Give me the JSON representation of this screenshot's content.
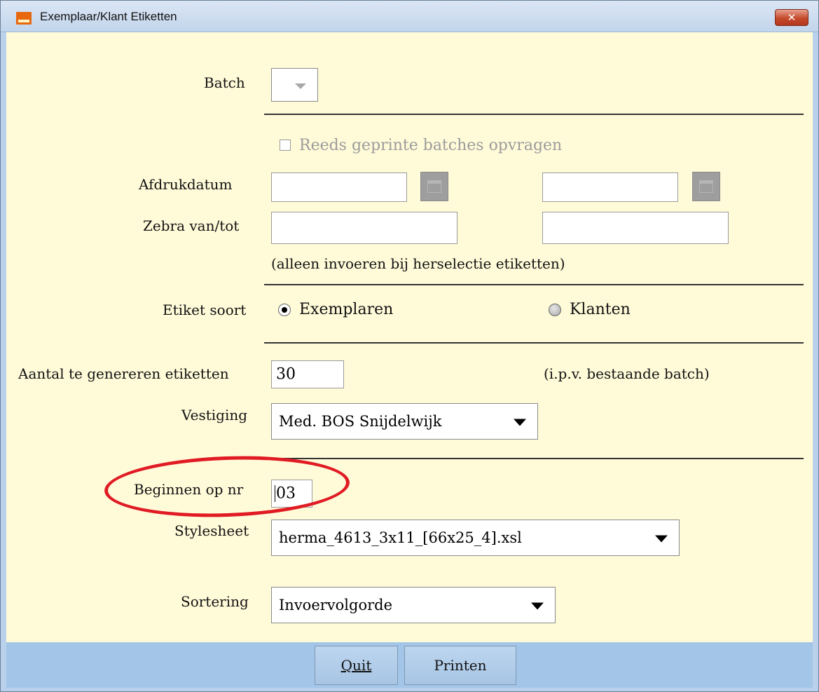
{
  "window": {
    "title": "Exemplaar/Klant Etiketten",
    "close_label": "✕"
  },
  "form": {
    "batch_label": "Batch",
    "batch_value": "",
    "reprinted_label": "Reeds geprinte batches opvragen",
    "print_date_label": "Afdrukdatum",
    "print_date_from": "",
    "print_date_to": "",
    "zebra_label": "Zebra van/tot",
    "zebra_from": "",
    "zebra_to": "",
    "reselect_note": "(alleen invoeren bij herselectie etiketten)",
    "label_type_label": "Etiket soort",
    "label_type_options": [
      "Exemplaren",
      "Klanten"
    ],
    "label_type_selected": "Exemplaren",
    "count_label": "Aantal te genereren etiketten",
    "count_value": "30",
    "count_note": "(i.p.v. bestaande batch)",
    "branch_label": "Vestiging",
    "branch_value": "Med. BOS Snijdelwijk",
    "start_label": "Beginnen op nr",
    "start_value": "03",
    "stylesheet_label": "Stylesheet",
    "stylesheet_value": "herma_4613_3x11_[66x25_4].xsl",
    "sort_label": "Sortering",
    "sort_value": "Invoervolgorde"
  },
  "buttons": {
    "quit_label": "Quit",
    "print_label": "Printen"
  },
  "colors": {
    "panel_bg": "#fffbd9",
    "footer_bg": "#a3c6e8",
    "highlight_ellipse": "#e11b24"
  }
}
